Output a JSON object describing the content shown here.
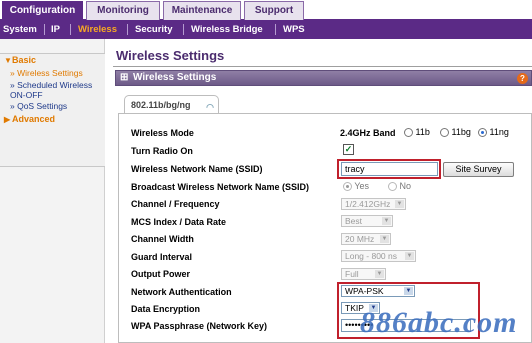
{
  "top_tabs": [
    "Configuration",
    "Monitoring",
    "Maintenance",
    "Support"
  ],
  "subnav": [
    "System",
    "IP",
    "Wireless",
    "Security",
    "Wireless Bridge",
    "WPS"
  ],
  "sidebar": {
    "basic": "Basic",
    "items": [
      "Wireless Settings",
      "Scheduled Wireless ON-OFF",
      "QoS Settings"
    ],
    "advanced": "Advanced"
  },
  "page_title": "Wireless Settings",
  "section_title": "Wireless Settings",
  "band_tab": "802.11b/bg/ng",
  "form": {
    "wireless_mode": {
      "label": "Wireless Mode",
      "band": "2.4GHz Band",
      "options": [
        "11b",
        "11bg",
        "11ng"
      ],
      "selected": "11ng"
    },
    "turn_radio_on": {
      "label": "Turn Radio On",
      "checked": true
    },
    "ssid": {
      "label": "Wireless Network Name (SSID)",
      "value": "tracy",
      "button": "Site Survey"
    },
    "broadcast_ssid": {
      "label": "Broadcast Wireless Network Name (SSID)",
      "options": [
        "Yes",
        "No"
      ],
      "selected": "Yes"
    },
    "channel_frequency": {
      "label": "Channel / Frequency",
      "value": "1/2.412GHz"
    },
    "mcs_index": {
      "label": "MCS Index / Data Rate",
      "value": "Best"
    },
    "channel_width": {
      "label": "Channel Width",
      "value": "20 MHz"
    },
    "guard_interval": {
      "label": "Guard Interval",
      "value": "Long - 800 ns"
    },
    "output_power": {
      "label": "Output Power",
      "value": "Full"
    },
    "network_authentication": {
      "label": "Network Authentication",
      "value": "WPA-PSK"
    },
    "data_encryption": {
      "label": "Data Encryption",
      "value": "TKIP"
    },
    "wpa_passphrase": {
      "label": "WPA Passphrase (Network Key)",
      "value": "•••••••••"
    }
  },
  "watermark": "886abc.com",
  "colors": {
    "primary": "#5b2a86",
    "active_nav": "#f7a823",
    "highlight": "#c0202c"
  }
}
